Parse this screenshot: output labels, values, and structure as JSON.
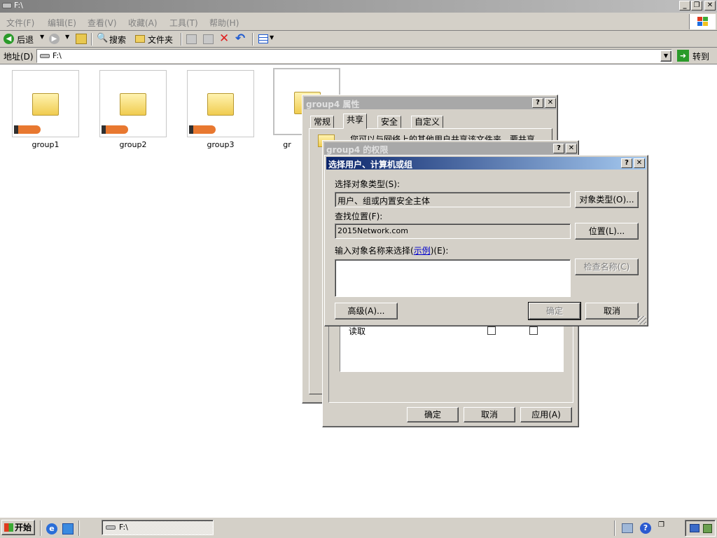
{
  "window": {
    "title": "F:\\"
  },
  "menu": [
    {
      "label": "文件(F)"
    },
    {
      "label": "编辑(E)"
    },
    {
      "label": "查看(V)"
    },
    {
      "label": "收藏(A)"
    },
    {
      "label": "工具(T)"
    },
    {
      "label": "帮助(H)"
    }
  ],
  "toolbar": {
    "back": "后退",
    "search": "搜索",
    "folders": "文件夹"
  },
  "address": {
    "label": "地址(D)",
    "value": "F:\\",
    "go": "转到"
  },
  "folders": [
    "group1",
    "group2",
    "group3",
    "gr"
  ],
  "props_dialog": {
    "title": "group4 属性",
    "tabs": [
      "常规",
      "共享",
      "安全",
      "自定义"
    ],
    "partial_text": "您可以与网络上的其他用户共享该文件夹。要共享"
  },
  "perm_dialog": {
    "title": "group4 的权限",
    "row_label": "读取",
    "ok": "确定",
    "cancel": "取消",
    "apply": "应用(A)"
  },
  "select_dialog": {
    "title": "选择用户、计算机或组",
    "object_type_label": "选择对象类型(S):",
    "object_type_value": "用户、组或内置安全主体",
    "object_type_btn": "对象类型(O)...",
    "location_label": "查找位置(F):",
    "location_value": "2015Network.com",
    "location_btn": "位置(L)...",
    "enter_label_a": "输入对象名称来选择(",
    "enter_label_link": "示例",
    "enter_label_b": ")(E):",
    "check_names_btn": "检查名称(C)",
    "advanced_btn": "高级(A)...",
    "ok": "确定",
    "cancel": "取消"
  },
  "taskbar": {
    "start": "开始",
    "task": "F:\\"
  },
  "colors": {
    "titlebar_inactive": "#a8a8a8",
    "titlebar_active": "#0a246a",
    "link": "#0000cc"
  }
}
